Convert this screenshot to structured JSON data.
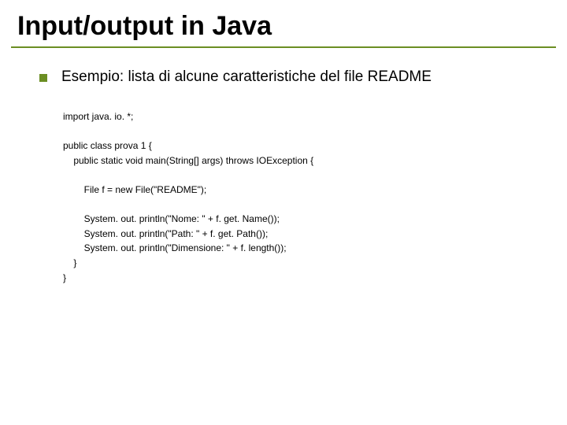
{
  "title": "Input/output in Java",
  "bullet": {
    "text": "Esempio: lista di alcune caratteristiche del file README"
  },
  "code": {
    "l1": "import java. io. *;",
    "l2": "",
    "l3": "public class prova 1 {",
    "l4": "    public static void main(String[] args) throws IOException {",
    "l5": "",
    "l6": "        File f = new File(\"README\");",
    "l7": "",
    "l8": "        System. out. println(\"Nome: \" + f. get. Name());",
    "l9": "        System. out. println(\"Path: \" + f. get. Path());",
    "l10": "        System. out. println(\"Dimensione: \" + f. length());",
    "l11": "    }",
    "l12": "}"
  }
}
